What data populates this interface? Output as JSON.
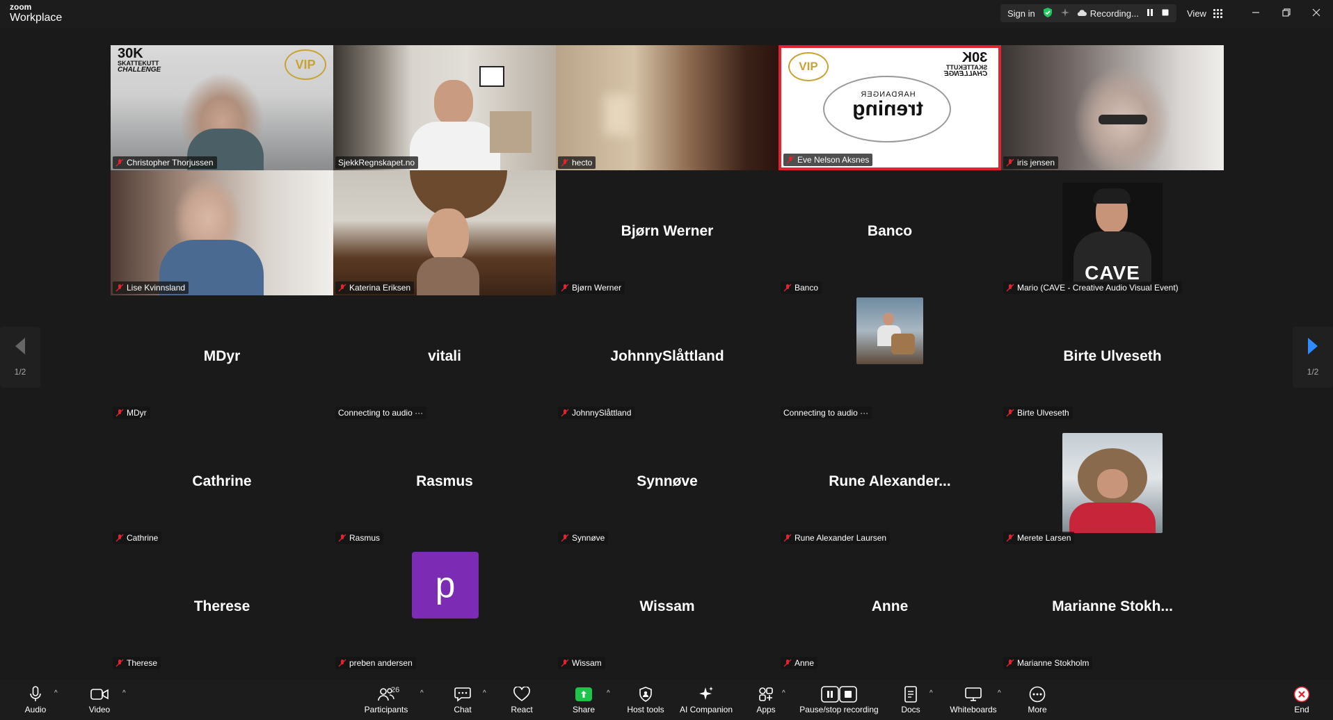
{
  "app": {
    "brand_small": "zoom",
    "brand_large": "Workplace"
  },
  "titlebar": {
    "sign_in": "Sign in",
    "recording": "Recording...",
    "view": "View"
  },
  "pager": {
    "left_page": "1/2",
    "right_page": "1/2"
  },
  "tiles": [
    {
      "name": "Christopher Thorjussen",
      "big": ""
    },
    {
      "name": "SjekkRegnskapet.no",
      "big": ""
    },
    {
      "name": "hecto",
      "big": ""
    },
    {
      "name": "Eve Nelson Aksnes",
      "big": ""
    },
    {
      "name": "iris jensen",
      "big": ""
    },
    {
      "name": "Lise Kvinnsland",
      "big": ""
    },
    {
      "name": "Katerina Eriksen",
      "big": ""
    },
    {
      "name": "Bjørn Werner",
      "big": "Bjørn Werner"
    },
    {
      "name": "Banco",
      "big": "Banco"
    },
    {
      "name": "Mario (CAVE - Creative Audio Visual Event)",
      "big": ""
    },
    {
      "name": "MDyr",
      "big": "MDyr"
    },
    {
      "name": "Connecting to audio ···",
      "big": "vitali"
    },
    {
      "name": "JohnnySlåttland",
      "big": "JohnnySlåttland"
    },
    {
      "name": "Connecting to audio ···",
      "big": ""
    },
    {
      "name": "Birte Ulveseth",
      "big": "Birte Ulveseth"
    },
    {
      "name": "Cathrine",
      "big": "Cathrine"
    },
    {
      "name": "Rasmus",
      "big": "Rasmus"
    },
    {
      "name": "Synnøve",
      "big": "Synnøve"
    },
    {
      "name": "Rune Alexander Laursen",
      "big": "Rune  Alexander..."
    },
    {
      "name": "Merete Larsen",
      "big": ""
    },
    {
      "name": "Therese",
      "big": "Therese"
    },
    {
      "name": "preben andersen",
      "big": ""
    },
    {
      "name": "Wissam",
      "big": "Wissam"
    },
    {
      "name": "Anne",
      "big": "Anne"
    },
    {
      "name": "Marianne Stokholm",
      "big": "Marianne  Stokh..."
    }
  ],
  "overlay_text": {
    "thirty_k": "30K",
    "skattekutt": "SKATTEKUTT",
    "challenge": "CHALLENGE",
    "vip": "VIP",
    "hardanger": "HARDANGER",
    "trening": "trening",
    "cave": "CAVE",
    "p_avatar": "p"
  },
  "toolbar": {
    "audio": "Audio",
    "video": "Video",
    "participants": "Participants",
    "participant_count": "26",
    "chat": "Chat",
    "react": "React",
    "share": "Share",
    "host_tools": "Host tools",
    "ai_companion": "AI Companion",
    "apps": "Apps",
    "pause_recording": "Pause/stop recording",
    "docs": "Docs",
    "whiteboards": "Whiteboards",
    "more": "More",
    "end": "End"
  },
  "colors": {
    "active_speaker": "#23d959",
    "share_green": "#1ec44a",
    "end_red": "#e0232c",
    "avatar_purple": "#7b2bb4",
    "arrow_blue": "#2d8cff"
  }
}
